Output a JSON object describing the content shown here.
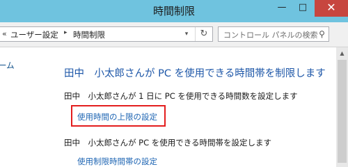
{
  "window": {
    "title": "時間制限",
    "minimize_glyph": "—",
    "maximize_glyph": "□",
    "close_glyph": "✕"
  },
  "navigation": {
    "overflow_glyph": "«",
    "breadcrumb": [
      "ユーザー設定",
      "時間制限"
    ],
    "separator_glyph": "▸",
    "dropdown_glyph": "▾",
    "refresh_glyph": "↻",
    "search_placeholder": "コントロール パネルの検索",
    "search_glyph": "⚲"
  },
  "sidebar": {
    "partial_text": "ーム"
  },
  "main": {
    "heading": "田中　小太郎さんが PC を使用できる時間帯を制限します",
    "hours_description": "田中　小太郎さんが 1 日に PC を使用できる時間数を設定します",
    "hours_link": "使用時間の上限の設定",
    "schedule_description": "田中　小太郎さんが PC を使用できる時間帯を設定します",
    "schedule_link": "使用制限時間帯の設定"
  },
  "colors": {
    "titlebar": "#6fc3df",
    "close_button": "#c7463f",
    "heading": "#1e57a8",
    "link": "#1e65b3",
    "highlight_box": "#e31d1d"
  }
}
